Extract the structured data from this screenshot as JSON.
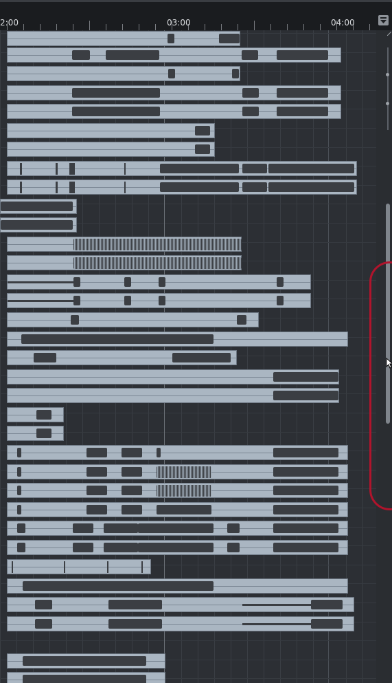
{
  "ruler": {
    "labels": [
      "2:00",
      "03:00",
      "04:00"
    ],
    "menu_icon": "dropdown-menu-icon"
  },
  "vertical_scroll": {
    "position_fraction": 0.4
  },
  "colors": {
    "clip_fill": "#aab6c2",
    "waveform": "#3b3e43",
    "background": "#2c2f34",
    "annotation": "#b0142c"
  },
  "tracks": [
    "track-1",
    "track-2",
    "track-3",
    "track-4",
    "track-5",
    "track-6",
    "track-7",
    "track-8",
    "track-9",
    "track-10",
    "track-11",
    "track-12",
    "track-13",
    "track-14",
    "track-15",
    "track-16",
    "track-17",
    "track-18",
    "track-19",
    "track-20",
    "track-21",
    "track-22",
    "track-23",
    "track-24",
    "track-25",
    "track-26",
    "track-27",
    "track-28",
    "track-29",
    "track-30",
    "track-31",
    "track-32",
    "track-33",
    "track-34"
  ]
}
